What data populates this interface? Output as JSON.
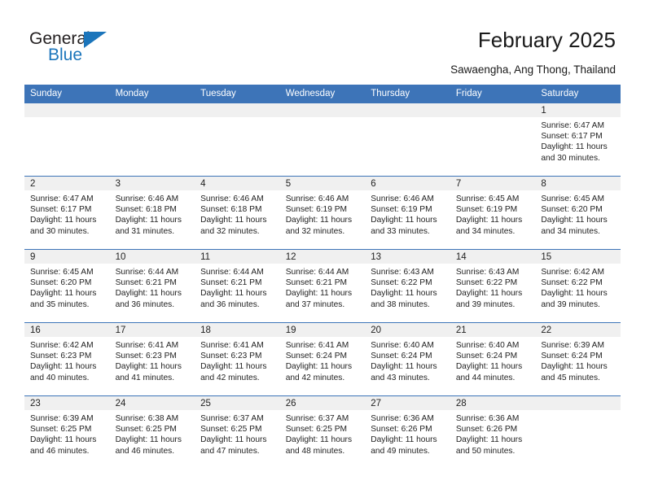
{
  "brand": {
    "name_part1": "General",
    "name_part2": "Blue",
    "triangle_icon": "triangle-icon",
    "accent_color": "#1b75bb"
  },
  "header": {
    "title": "February 2025",
    "subtitle": "Sawaengha, Ang Thong, Thailand"
  },
  "calendar": {
    "header_bg": "#3d74b8",
    "daynum_bg": "#f0f0f0",
    "weekdays": [
      "Sunday",
      "Monday",
      "Tuesday",
      "Wednesday",
      "Thursday",
      "Friday",
      "Saturday"
    ],
    "weeks": [
      [
        {
          "day": "",
          "sunrise": "",
          "sunset": "",
          "daylight_line1": "",
          "daylight_line2": ""
        },
        {
          "day": "",
          "sunrise": "",
          "sunset": "",
          "daylight_line1": "",
          "daylight_line2": ""
        },
        {
          "day": "",
          "sunrise": "",
          "sunset": "",
          "daylight_line1": "",
          "daylight_line2": ""
        },
        {
          "day": "",
          "sunrise": "",
          "sunset": "",
          "daylight_line1": "",
          "daylight_line2": ""
        },
        {
          "day": "",
          "sunrise": "",
          "sunset": "",
          "daylight_line1": "",
          "daylight_line2": ""
        },
        {
          "day": "",
          "sunrise": "",
          "sunset": "",
          "daylight_line1": "",
          "daylight_line2": ""
        },
        {
          "day": "1",
          "sunrise": "Sunrise: 6:47 AM",
          "sunset": "Sunset: 6:17 PM",
          "daylight_line1": "Daylight: 11 hours",
          "daylight_line2": "and 30 minutes."
        }
      ],
      [
        {
          "day": "2",
          "sunrise": "Sunrise: 6:47 AM",
          "sunset": "Sunset: 6:17 PM",
          "daylight_line1": "Daylight: 11 hours",
          "daylight_line2": "and 30 minutes."
        },
        {
          "day": "3",
          "sunrise": "Sunrise: 6:46 AM",
          "sunset": "Sunset: 6:18 PM",
          "daylight_line1": "Daylight: 11 hours",
          "daylight_line2": "and 31 minutes."
        },
        {
          "day": "4",
          "sunrise": "Sunrise: 6:46 AM",
          "sunset": "Sunset: 6:18 PM",
          "daylight_line1": "Daylight: 11 hours",
          "daylight_line2": "and 32 minutes."
        },
        {
          "day": "5",
          "sunrise": "Sunrise: 6:46 AM",
          "sunset": "Sunset: 6:19 PM",
          "daylight_line1": "Daylight: 11 hours",
          "daylight_line2": "and 32 minutes."
        },
        {
          "day": "6",
          "sunrise": "Sunrise: 6:46 AM",
          "sunset": "Sunset: 6:19 PM",
          "daylight_line1": "Daylight: 11 hours",
          "daylight_line2": "and 33 minutes."
        },
        {
          "day": "7",
          "sunrise": "Sunrise: 6:45 AM",
          "sunset": "Sunset: 6:19 PM",
          "daylight_line1": "Daylight: 11 hours",
          "daylight_line2": "and 34 minutes."
        },
        {
          "day": "8",
          "sunrise": "Sunrise: 6:45 AM",
          "sunset": "Sunset: 6:20 PM",
          "daylight_line1": "Daylight: 11 hours",
          "daylight_line2": "and 34 minutes."
        }
      ],
      [
        {
          "day": "9",
          "sunrise": "Sunrise: 6:45 AM",
          "sunset": "Sunset: 6:20 PM",
          "daylight_line1": "Daylight: 11 hours",
          "daylight_line2": "and 35 minutes."
        },
        {
          "day": "10",
          "sunrise": "Sunrise: 6:44 AM",
          "sunset": "Sunset: 6:21 PM",
          "daylight_line1": "Daylight: 11 hours",
          "daylight_line2": "and 36 minutes."
        },
        {
          "day": "11",
          "sunrise": "Sunrise: 6:44 AM",
          "sunset": "Sunset: 6:21 PM",
          "daylight_line1": "Daylight: 11 hours",
          "daylight_line2": "and 36 minutes."
        },
        {
          "day": "12",
          "sunrise": "Sunrise: 6:44 AM",
          "sunset": "Sunset: 6:21 PM",
          "daylight_line1": "Daylight: 11 hours",
          "daylight_line2": "and 37 minutes."
        },
        {
          "day": "13",
          "sunrise": "Sunrise: 6:43 AM",
          "sunset": "Sunset: 6:22 PM",
          "daylight_line1": "Daylight: 11 hours",
          "daylight_line2": "and 38 minutes."
        },
        {
          "day": "14",
          "sunrise": "Sunrise: 6:43 AM",
          "sunset": "Sunset: 6:22 PM",
          "daylight_line1": "Daylight: 11 hours",
          "daylight_line2": "and 39 minutes."
        },
        {
          "day": "15",
          "sunrise": "Sunrise: 6:42 AM",
          "sunset": "Sunset: 6:22 PM",
          "daylight_line1": "Daylight: 11 hours",
          "daylight_line2": "and 39 minutes."
        }
      ],
      [
        {
          "day": "16",
          "sunrise": "Sunrise: 6:42 AM",
          "sunset": "Sunset: 6:23 PM",
          "daylight_line1": "Daylight: 11 hours",
          "daylight_line2": "and 40 minutes."
        },
        {
          "day": "17",
          "sunrise": "Sunrise: 6:41 AM",
          "sunset": "Sunset: 6:23 PM",
          "daylight_line1": "Daylight: 11 hours",
          "daylight_line2": "and 41 minutes."
        },
        {
          "day": "18",
          "sunrise": "Sunrise: 6:41 AM",
          "sunset": "Sunset: 6:23 PM",
          "daylight_line1": "Daylight: 11 hours",
          "daylight_line2": "and 42 minutes."
        },
        {
          "day": "19",
          "sunrise": "Sunrise: 6:41 AM",
          "sunset": "Sunset: 6:24 PM",
          "daylight_line1": "Daylight: 11 hours",
          "daylight_line2": "and 42 minutes."
        },
        {
          "day": "20",
          "sunrise": "Sunrise: 6:40 AM",
          "sunset": "Sunset: 6:24 PM",
          "daylight_line1": "Daylight: 11 hours",
          "daylight_line2": "and 43 minutes."
        },
        {
          "day": "21",
          "sunrise": "Sunrise: 6:40 AM",
          "sunset": "Sunset: 6:24 PM",
          "daylight_line1": "Daylight: 11 hours",
          "daylight_line2": "and 44 minutes."
        },
        {
          "day": "22",
          "sunrise": "Sunrise: 6:39 AM",
          "sunset": "Sunset: 6:24 PM",
          "daylight_line1": "Daylight: 11 hours",
          "daylight_line2": "and 45 minutes."
        }
      ],
      [
        {
          "day": "23",
          "sunrise": "Sunrise: 6:39 AM",
          "sunset": "Sunset: 6:25 PM",
          "daylight_line1": "Daylight: 11 hours",
          "daylight_line2": "and 46 minutes."
        },
        {
          "day": "24",
          "sunrise": "Sunrise: 6:38 AM",
          "sunset": "Sunset: 6:25 PM",
          "daylight_line1": "Daylight: 11 hours",
          "daylight_line2": "and 46 minutes."
        },
        {
          "day": "25",
          "sunrise": "Sunrise: 6:37 AM",
          "sunset": "Sunset: 6:25 PM",
          "daylight_line1": "Daylight: 11 hours",
          "daylight_line2": "and 47 minutes."
        },
        {
          "day": "26",
          "sunrise": "Sunrise: 6:37 AM",
          "sunset": "Sunset: 6:25 PM",
          "daylight_line1": "Daylight: 11 hours",
          "daylight_line2": "and 48 minutes."
        },
        {
          "day": "27",
          "sunrise": "Sunrise: 6:36 AM",
          "sunset": "Sunset: 6:26 PM",
          "daylight_line1": "Daylight: 11 hours",
          "daylight_line2": "and 49 minutes."
        },
        {
          "day": "28",
          "sunrise": "Sunrise: 6:36 AM",
          "sunset": "Sunset: 6:26 PM",
          "daylight_line1": "Daylight: 11 hours",
          "daylight_line2": "and 50 minutes."
        },
        {
          "day": "",
          "sunrise": "",
          "sunset": "",
          "daylight_line1": "",
          "daylight_line2": ""
        }
      ]
    ]
  }
}
